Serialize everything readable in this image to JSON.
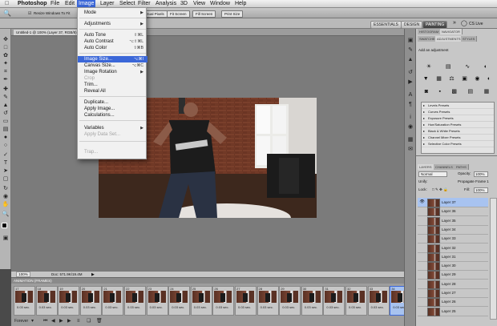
{
  "menubar": {
    "apple": "",
    "items": [
      "Photoshop",
      "File",
      "Edit",
      "Image",
      "Layer",
      "Select",
      "Filter",
      "Analysis",
      "3D",
      "View",
      "Window",
      "Help"
    ]
  },
  "options": {
    "resize_label": "Resize Windows To Fit",
    "btns": [
      "Actual Pixels",
      "Fit Screen",
      "Fill Screen",
      "Print Size"
    ]
  },
  "workspace": {
    "essentials": "ESSENTIALS",
    "design": "DESIGN",
    "painting": "PAINTING",
    "cslive": "CS Live"
  },
  "document": {
    "tab": "Untitled-1 @ 100% (Layer 37, RGB/8) *",
    "zoom": "100%",
    "doc_info": "Doc: 571.9K/19.4M"
  },
  "image_menu": {
    "mode": "Mode",
    "adjustments": "Adjustments",
    "auto_tone": "Auto Tone",
    "auto_tone_sc": "⇧⌘L",
    "auto_contrast": "Auto Contrast",
    "auto_contrast_sc": "⌥⇧⌘L",
    "auto_color": "Auto Color",
    "auto_color_sc": "⇧⌘B",
    "image_size": "Image Size...",
    "image_size_sc": "⌥⌘I",
    "canvas_size": "Canvas Size...",
    "canvas_size_sc": "⌥⌘C",
    "rotation": "Image Rotation",
    "crop": "Crop",
    "trim": "Trim...",
    "reveal": "Reveal All",
    "duplicate": "Duplicate...",
    "apply_image": "Apply Image...",
    "calculations": "Calculations...",
    "variables": "Variables",
    "apply_data": "Apply Data Set...",
    "trap": "Trap..."
  },
  "animation": {
    "header": "ANIMATION (FRAMES)",
    "forever": "Forever",
    "frames": [
      {
        "n": "17",
        "d": "0.03 sec."
      },
      {
        "n": "18",
        "d": "0.03 sec."
      },
      {
        "n": "19",
        "d": "0.03 sec."
      },
      {
        "n": "20",
        "d": "0.03 sec."
      },
      {
        "n": "21",
        "d": "0.03 sec."
      },
      {
        "n": "22",
        "d": "0.03 sec."
      },
      {
        "n": "23",
        "d": "0.03 sec."
      },
      {
        "n": "24",
        "d": "0.03 sec."
      },
      {
        "n": "25",
        "d": "0.03 sec."
      },
      {
        "n": "26",
        "d": "0.03 sec."
      },
      {
        "n": "27",
        "d": "0.03 sec."
      },
      {
        "n": "28",
        "d": "0.03 sec."
      },
      {
        "n": "29",
        "d": "0.03 sec."
      },
      {
        "n": "30",
        "d": "0.03 sec."
      },
      {
        "n": "31",
        "d": "0.03 sec."
      },
      {
        "n": "32",
        "d": "0.03 sec."
      },
      {
        "n": "33",
        "d": "0.03 sec."
      },
      {
        "n": "34",
        "d": "0.03 sec."
      }
    ]
  },
  "adjust_panel": {
    "tabs": [
      "HISTOGRAM",
      "NAVIGATOR"
    ],
    "tabs2": [
      "SWATCHES",
      "ADJUSTMENTS",
      "STYLES"
    ],
    "title": "Add an adjustment",
    "presets": [
      "Levels Presets",
      "Curves Presets",
      "Exposure Presets",
      "Hue/Saturation Presets",
      "Black & White Presets",
      "Channel Mixer Presets",
      "Selective Color Presets"
    ]
  },
  "layers_panel": {
    "tabs": [
      "LAYERS",
      "CHANNELS",
      "PATHS"
    ],
    "blend": "Normal",
    "opacity_label": "Opacity:",
    "opacity": "100%",
    "unify": "Unify:",
    "propagate": "Propagate Frame 1",
    "lock": "Lock:",
    "fill_label": "Fill:",
    "fill": "100%",
    "layers": [
      "Layer 37",
      "Layer 36",
      "Layer 35",
      "Layer 34",
      "Layer 33",
      "Layer 32",
      "Layer 31",
      "Layer 30",
      "Layer 29",
      "Layer 28",
      "Layer 27",
      "Layer 26",
      "Layer 25"
    ]
  }
}
